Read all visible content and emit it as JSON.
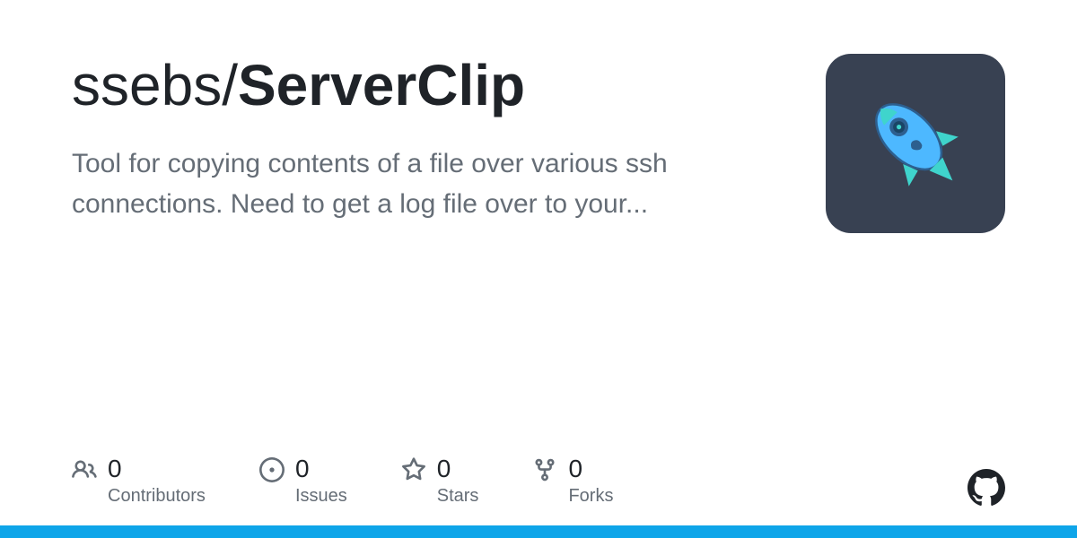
{
  "repo": {
    "owner": "ssebs",
    "separator": "/",
    "name": "ServerClip"
  },
  "description": "Tool for copying contents of a file over various ssh connections. Need to get a log file over to your...",
  "stats": {
    "contributors": {
      "value": "0",
      "label": "Contributors"
    },
    "issues": {
      "value": "0",
      "label": "Issues"
    },
    "stars": {
      "value": "0",
      "label": "Stars"
    },
    "forks": {
      "value": "0",
      "label": "Forks"
    }
  }
}
